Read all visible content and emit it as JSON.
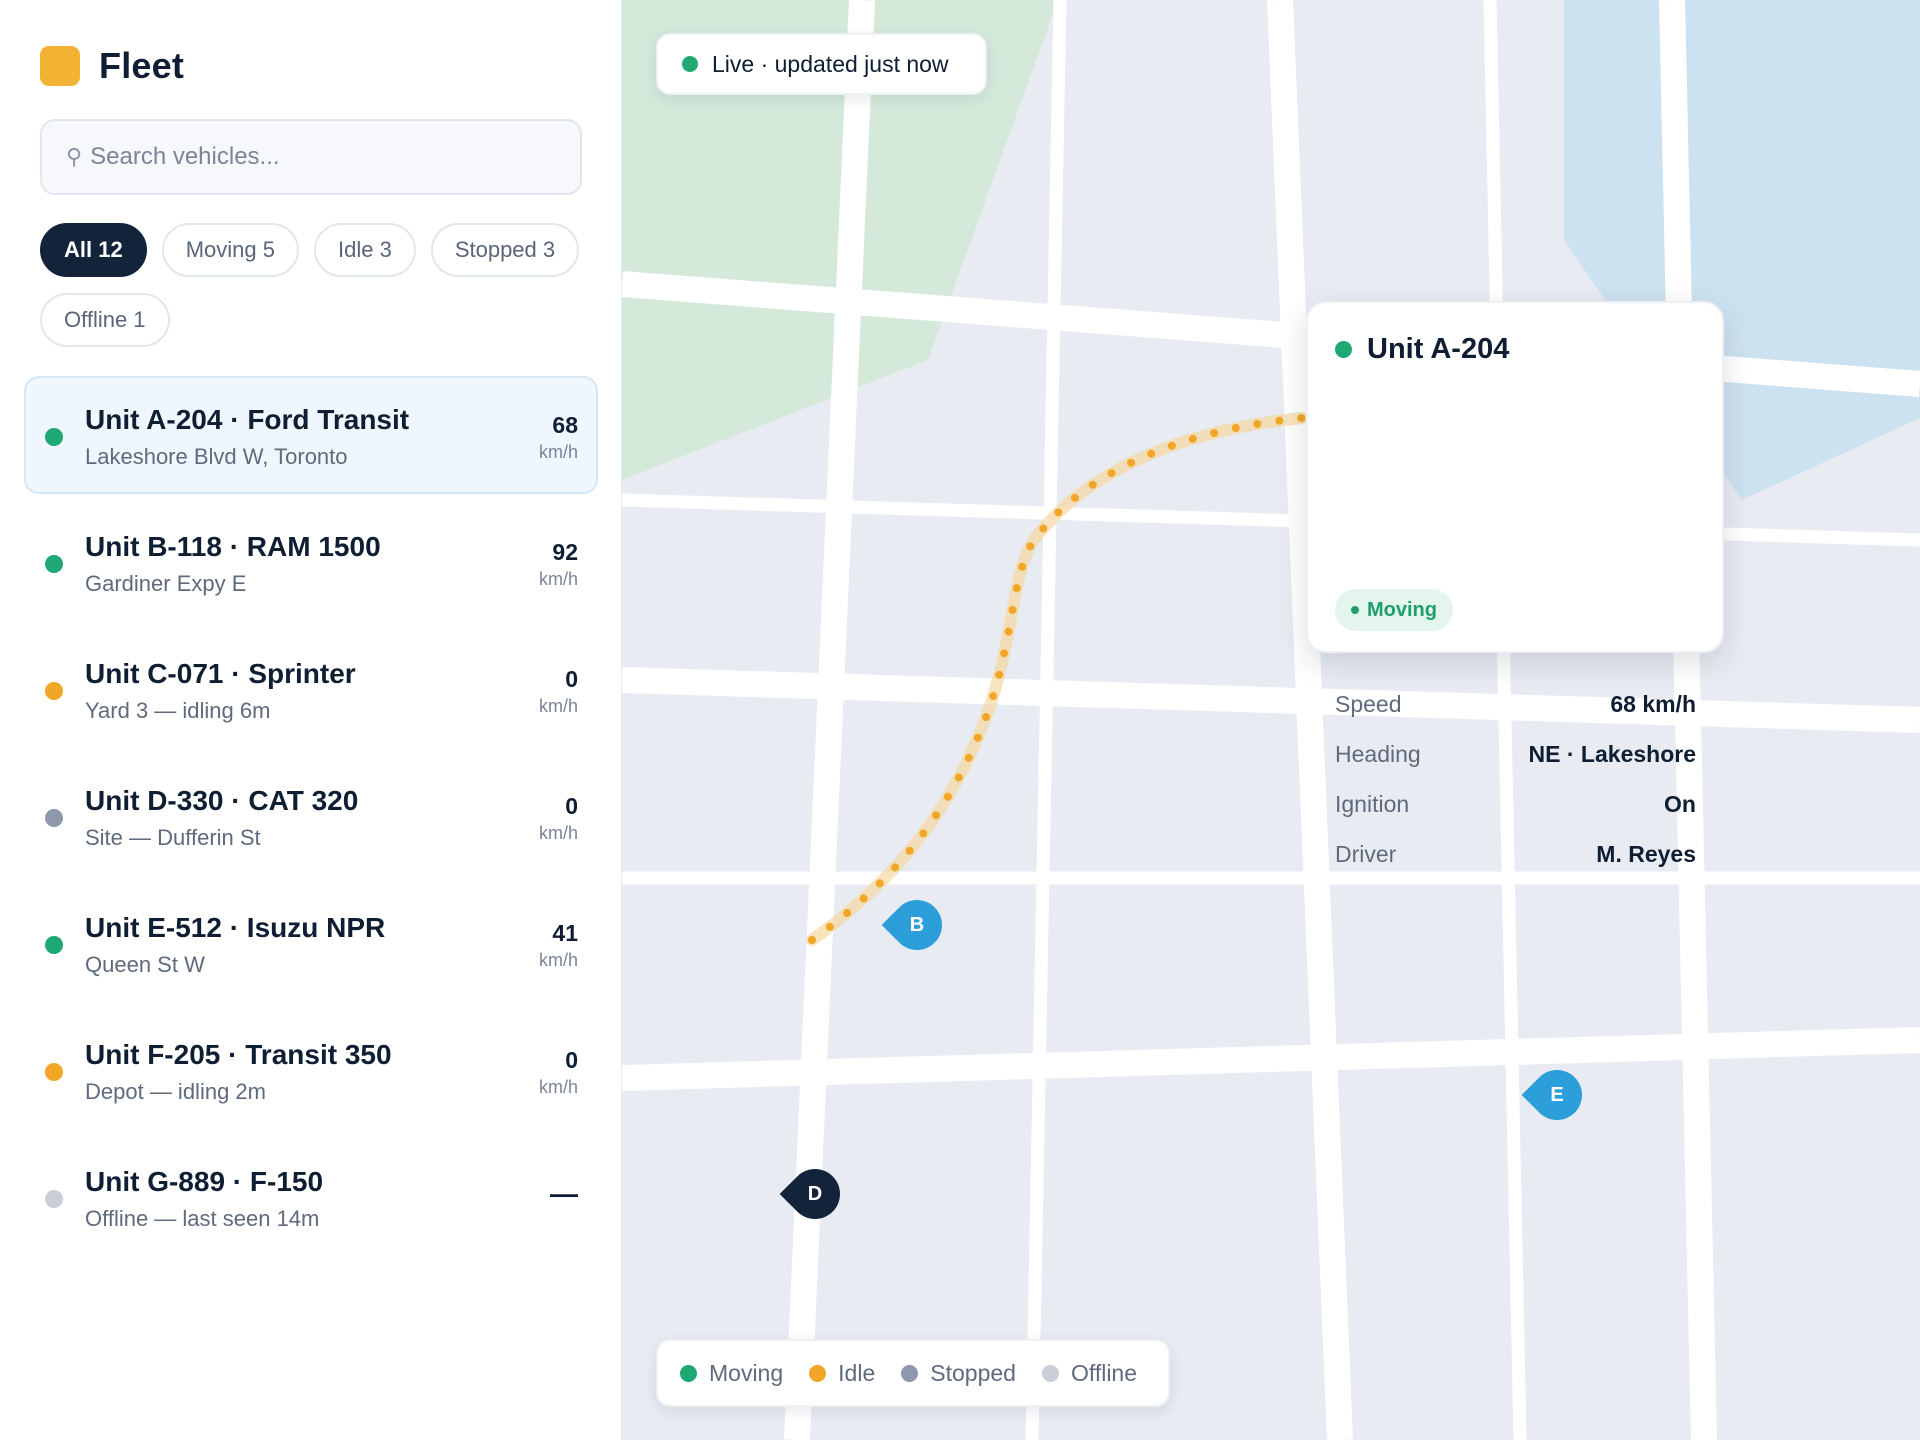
{
  "app": {
    "title": "Fleet"
  },
  "colors": {
    "moving": "#1fa774",
    "idle": "#f0a728",
    "stopped": "#8f98aa",
    "offline": "#c9ced8",
    "accent": "#13233a",
    "brand": "#f2b233",
    "marker_blue": "#2c9fdb",
    "marker_dark": "#13233a"
  },
  "search": {
    "placeholder": "Search vehicles..."
  },
  "filters": [
    {
      "label": "All 12",
      "active": true
    },
    {
      "label": "Moving 5",
      "active": false
    },
    {
      "label": "Idle 3",
      "active": false
    },
    {
      "label": "Stopped 3",
      "active": false
    },
    {
      "label": "Offline 1",
      "active": false
    }
  ],
  "vehicles": [
    {
      "title": "Unit A-204 · Ford Transit",
      "location": "Lakeshore Blvd W, Toronto",
      "speed": "68",
      "unit": "km/h",
      "status": "moving",
      "selected": true
    },
    {
      "title": "Unit B-118 · RAM 1500",
      "location": "Gardiner Expy E",
      "speed": "92",
      "unit": "km/h",
      "status": "moving",
      "selected": false
    },
    {
      "title": "Unit C-071 · Sprinter",
      "location": "Yard 3 — idling 6m",
      "speed": "0",
      "unit": "km/h",
      "status": "idle",
      "selected": false
    },
    {
      "title": "Unit D-330 · CAT 320",
      "location": "Site — Dufferin St",
      "speed": "0",
      "unit": "km/h",
      "status": "stopped",
      "selected": false
    },
    {
      "title": "Unit E-512 · Isuzu NPR",
      "location": "Queen St W",
      "speed": "41",
      "unit": "km/h",
      "status": "moving",
      "selected": false
    },
    {
      "title": "Unit F-205 · Transit 350",
      "location": "Depot — idling 2m",
      "speed": "0",
      "unit": "km/h",
      "status": "idle",
      "selected": false
    },
    {
      "title": "Unit G-889 · F-150",
      "location": "Offline — last seen 14m",
      "speed": "—",
      "unit": "",
      "status": "offline",
      "selected": false
    }
  ],
  "map": {
    "live_text": "Live · updated just now",
    "popup": {
      "title": "Unit A-204",
      "rows": [
        {
          "label": "Speed",
          "value": "68 km/h"
        },
        {
          "label": "Heading",
          "value": "NE · Lakeshore"
        },
        {
          "label": "Ignition",
          "value": "On"
        },
        {
          "label": "Driver",
          "value": "M. Reyes"
        }
      ],
      "badge": "Moving"
    },
    "markers": [
      {
        "letter": "B",
        "color": "#2c9fdb"
      },
      {
        "letter": "E",
        "color": "#2c9fdb"
      },
      {
        "letter": "D",
        "color": "#13233a"
      }
    ],
    "legend": [
      {
        "label": "Moving",
        "color": "#1fa774"
      },
      {
        "label": "Idle",
        "color": "#f0a728"
      },
      {
        "label": "Stopped",
        "color": "#8f98aa"
      },
      {
        "label": "Offline",
        "color": "#c9ced8"
      }
    ]
  }
}
